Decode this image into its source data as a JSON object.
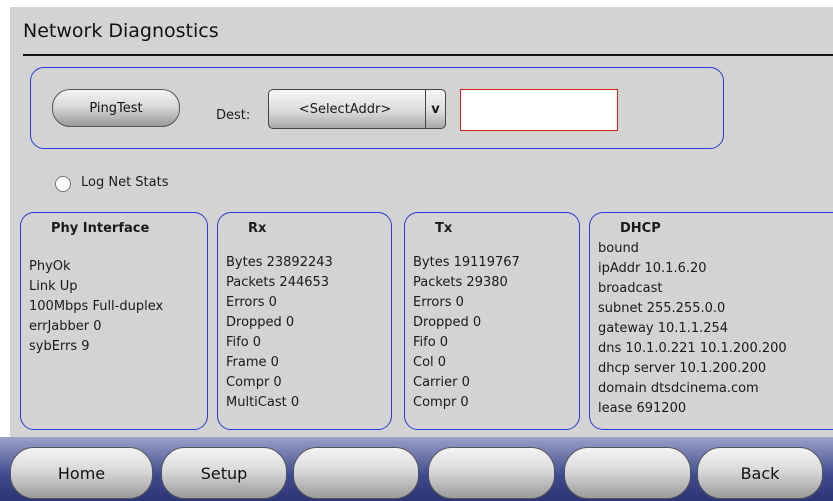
{
  "title": "Network Diagnostics",
  "ping": {
    "button_label": "PingTest",
    "dest_label": "Dest:",
    "select_value": "<SelectAddr>",
    "select_arrow": "v",
    "address_value": ""
  },
  "log_stats": {
    "label": "Log Net Stats",
    "checked": false
  },
  "phy": {
    "title": "Phy Interface",
    "lines": [
      "PhyOk",
      "Link Up",
      "100Mbps Full-duplex",
      "errJabber 0",
      "sybErrs 9"
    ]
  },
  "rx": {
    "title": "Rx",
    "lines": [
      "Bytes 23892243",
      "Packets 244653",
      "Errors 0",
      "Dropped 0",
      "Fifo 0",
      "Frame 0",
      "Compr 0",
      "MultiCast 0"
    ]
  },
  "tx": {
    "title": "Tx",
    "lines": [
      "Bytes 19119767",
      "Packets 29380",
      "Errors 0",
      "Dropped 0",
      "Fifo 0",
      "Col 0",
      "Carrier 0",
      "Compr 0"
    ]
  },
  "dhcp": {
    "title": "DHCP",
    "lines": [
      "bound",
      "ipAddr 10.1.6.20",
      "broadcast",
      "subnet 255.255.0.0",
      "gateway 10.1.1.254",
      "dns 10.1.0.221 10.1.200.200",
      "dhcp server 10.1.200.200",
      "domain dtsdcinema.com",
      "lease 691200"
    ]
  },
  "nav": {
    "home": "Home",
    "setup": "Setup",
    "blank3": "",
    "blank4": "",
    "blank5": "",
    "back": "Back"
  },
  "colors": {
    "panel_border": "#2a3cd8",
    "input_border": "#d81b1b",
    "navbar": "#3f4a8e",
    "screen_bg": "#d3d3d3"
  }
}
